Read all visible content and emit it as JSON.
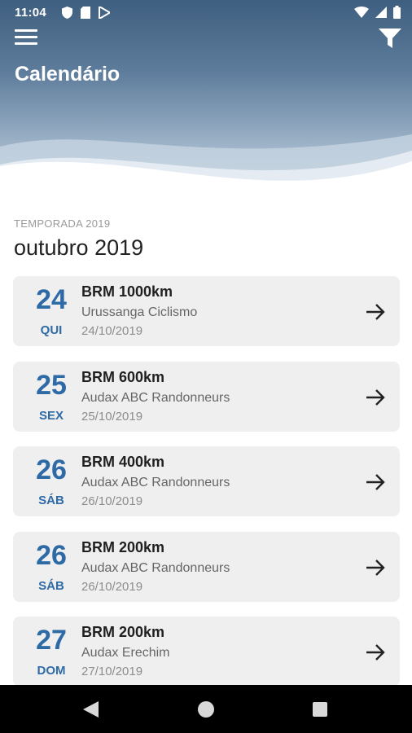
{
  "status_bar": {
    "time": "11:04",
    "icons": [
      "shield-icon",
      "sim-card-icon",
      "play-store-icon",
      "wifi-icon",
      "signal-icon",
      "battery-icon"
    ]
  },
  "header": {
    "title": "Calendário",
    "menu_icon": "hamburger-menu-icon",
    "filter_icon": "filter-funnel-icon"
  },
  "season": {
    "label": "TEMPORADA 2019",
    "month": "outubro 2019"
  },
  "events": [
    {
      "day": "24",
      "weekday": "QUI",
      "name": "BRM 1000km",
      "organizer": "Urussanga Ciclismo",
      "date": "24/10/2019"
    },
    {
      "day": "25",
      "weekday": "SEX",
      "name": "BRM 600km",
      "organizer": "Audax ABC Randonneurs",
      "date": "25/10/2019"
    },
    {
      "day": "26",
      "weekday": "SÁB",
      "name": "BRM 400km",
      "organizer": "Audax ABC Randonneurs",
      "date": "26/10/2019"
    },
    {
      "day": "26",
      "weekday": "SÁB",
      "name": "BRM 200km",
      "organizer": "Audax ABC Randonneurs",
      "date": "26/10/2019"
    },
    {
      "day": "27",
      "weekday": "DOM",
      "name": "BRM 200km",
      "organizer": "Audax Erechim",
      "date": "27/10/2019"
    }
  ],
  "nav_bar": {
    "icons": [
      "back-icon",
      "home-icon",
      "recents-icon"
    ]
  },
  "colors": {
    "accent": "#2e6aa6",
    "card_background": "#efefef",
    "header_dark": "#3f5f80"
  }
}
